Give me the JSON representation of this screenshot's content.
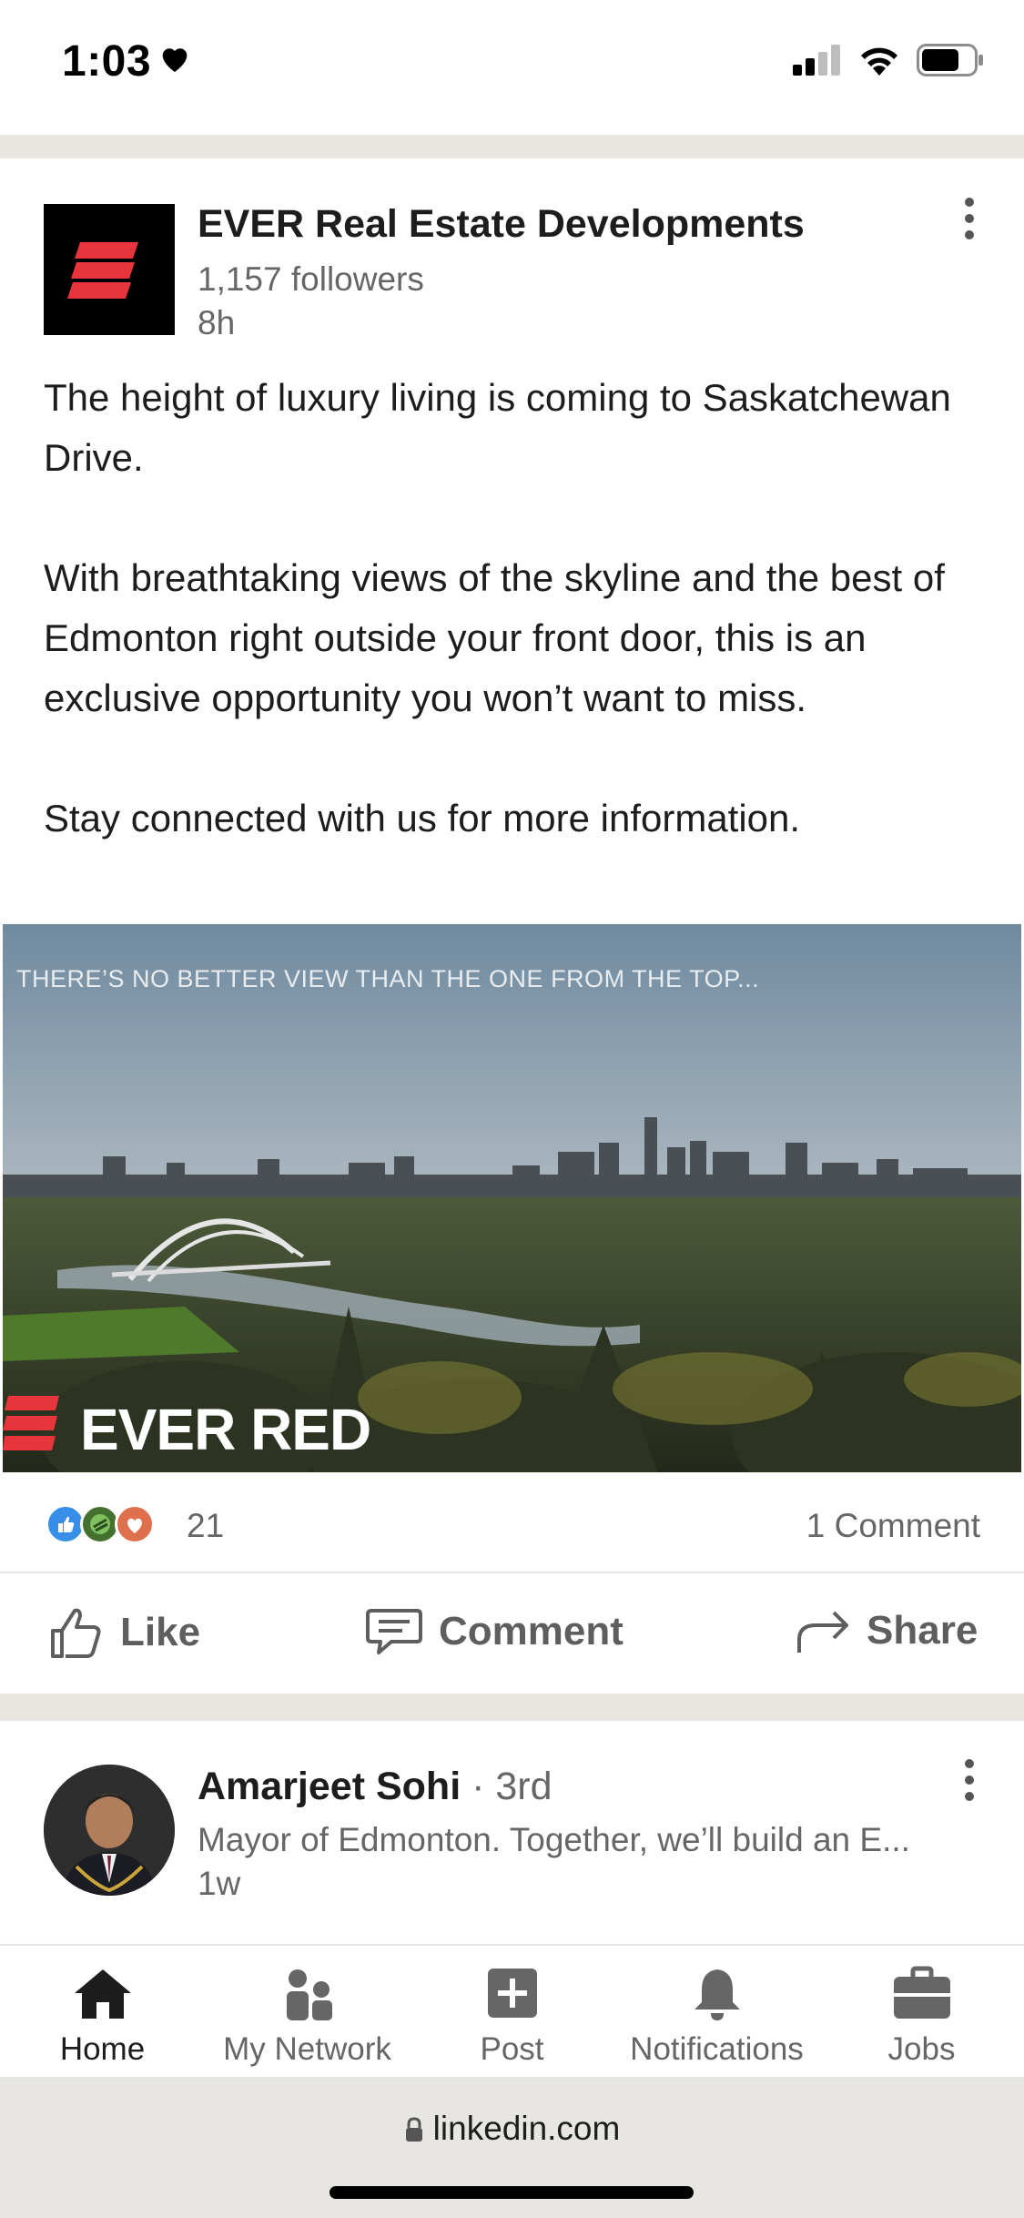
{
  "status_bar": {
    "time": "1:03"
  },
  "post1": {
    "author": "EVER Real Estate Developments",
    "followers": "1,157 followers",
    "time": "8h",
    "text": [
      "The height of luxury living is coming to Saskatchewan Drive.",
      "With breathtaking views of the skyline and the best of Edmonton right outside your front door, this is an exclusive opportunity you won’t want to miss.",
      "Stay connected with us for more information."
    ],
    "image_caption": "THERE’S NO BETTER VIEW THAN THE ONE FROM THE TOP...",
    "image_brand": "EVER RED",
    "reaction_count": "21",
    "comment_count": "1 Comment",
    "actions": {
      "like": "Like",
      "comment": "Comment",
      "share": "Share"
    }
  },
  "post2": {
    "author": "Amarjeet Sohi",
    "degree": " · 3rd",
    "headline": "Mayor of Edmonton. Together, we’ll build an E...",
    "time": "1w"
  },
  "bottom_nav": [
    {
      "label": "Home",
      "icon": "home-icon"
    },
    {
      "label": "My Network",
      "icon": "network-icon"
    },
    {
      "label": "Post",
      "icon": "post-icon"
    },
    {
      "label": "Notifications",
      "icon": "bell-icon"
    },
    {
      "label": "Jobs",
      "icon": "briefcase-icon"
    }
  ],
  "url_bar": {
    "url": "linkedin.com"
  },
  "colors": {
    "brand_red": "#e8343b",
    "text_dark": "#1d1d1d",
    "text_muted": "#666666",
    "like_blue": "#378fe9"
  }
}
